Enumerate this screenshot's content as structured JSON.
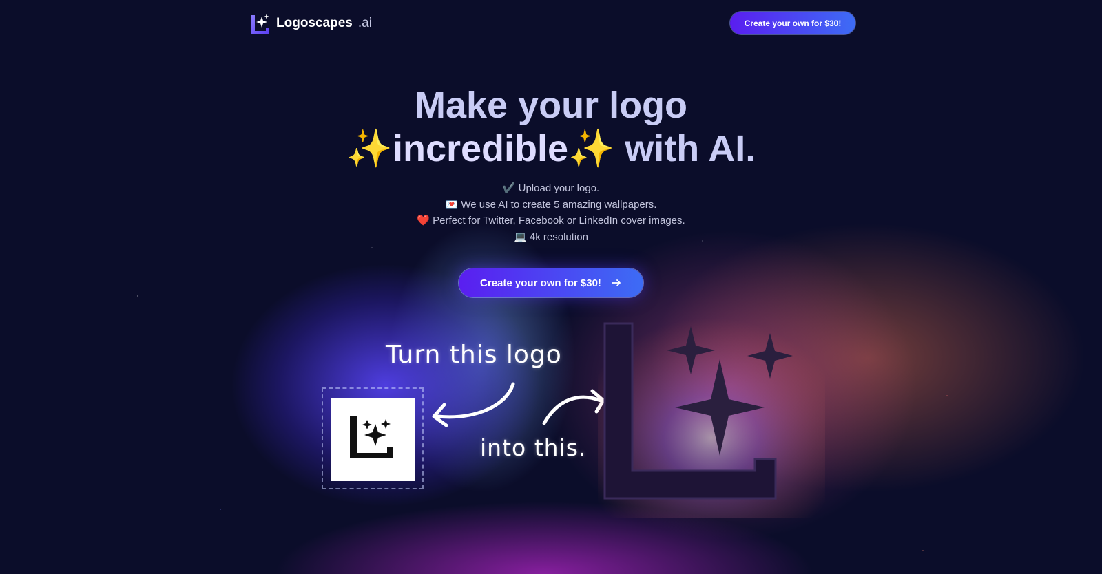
{
  "header": {
    "brand_name": "Logoscapes",
    "brand_tld": ".ai",
    "cta_label": "Create your own for $30!"
  },
  "hero": {
    "title_line1": "Make your logo",
    "title_emoji": "✨",
    "title_highlight": "incredible",
    "title_rest": " with AI."
  },
  "features": [
    "✔️ Upload your logo.",
    "💌 We use AI to create 5 amazing wallpapers.",
    "❤️ Perfect for Twitter, Facebook or LinkedIn cover images.",
    "💻 4k resolution"
  ],
  "cta_main": {
    "label": "Create your own for $30!",
    "icon": "arrow-right-icon"
  },
  "showcase": {
    "caption_before": "Turn this logo",
    "caption_after": "into this.",
    "icons": [
      "logo-icon",
      "curved-arrow-icon"
    ]
  },
  "colors": {
    "background": "#0b0d2a",
    "button_gradient_start": "#5a1ef0",
    "button_gradient_end": "#3d6cf5",
    "title": "#c9ccf5"
  }
}
